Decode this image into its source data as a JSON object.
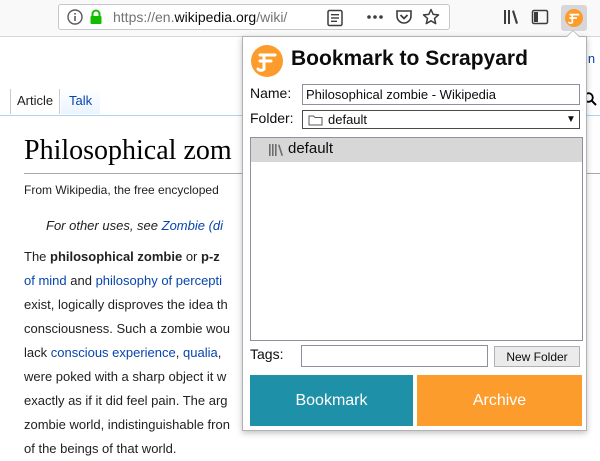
{
  "browser": {
    "url_prefix": "https://en.",
    "url_domain": "wikipedia.org",
    "url_suffix": "/wiki/",
    "accent": "#12bc00"
  },
  "wiki": {
    "tabs": {
      "article": "Article",
      "talk": "Talk"
    },
    "right_link": "in",
    "title": "Philosophical zom",
    "tagline": "From Wikipedia, the free encycloped",
    "hatnote_prefix": "For other uses, see ",
    "hatnote_link": "Zombie (di",
    "paragraph": {
      "l1_a": "The ",
      "l1_b": "philosophical zombie",
      "l1_c": " or ",
      "l1_d": "p-z",
      "l2_link1": "of mind",
      "l2_mid": " and ",
      "l2_link2": "philosophy of percepti",
      "l3": "exist, logically disproves the idea th",
      "l4": "consciousness. Such a zombie wou",
      "l5_a": "lack ",
      "l5_link1": "conscious experience",
      "l5_b": ", ",
      "l5_link2": "qualia",
      "l5_c": ",",
      "l6": "were poked with a sharp object it w",
      "l7": "exactly as if it did feel pain. The arg",
      "l8": "zombie world, indistinguishable fron",
      "l9": "of the beings of that world."
    }
  },
  "popup": {
    "title": "Bookmark to Scrapyard",
    "name_label": "Name:",
    "name_value": "Philosophical zombie - Wikipedia",
    "folder_label": "Folder:",
    "folder_value": "default",
    "tree_item": "default",
    "tags_label": "Tags:",
    "tags_value": "",
    "new_folder_label": "New Folder",
    "bookmark_label": "Bookmark",
    "archive_label": "Archive",
    "colors": {
      "bookmark": "#1e91a8",
      "archive": "#fc9c2c",
      "logo": "#fc9c2c"
    }
  }
}
